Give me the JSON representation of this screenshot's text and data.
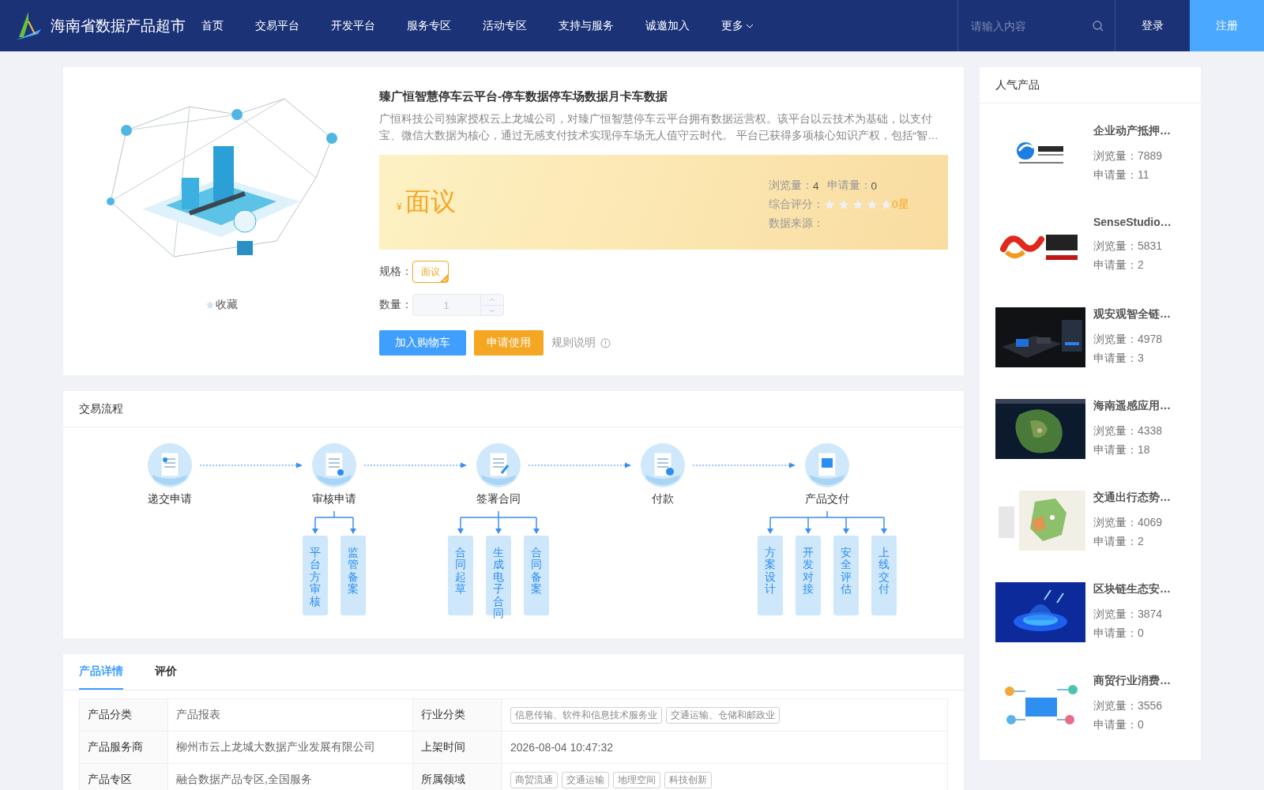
{
  "header": {
    "site_name": "海南省数据产品超市",
    "nav": [
      {
        "label": "首页",
        "dropdown": false
      },
      {
        "label": "交易平台",
        "dropdown": false
      },
      {
        "label": "开发平台",
        "dropdown": false
      },
      {
        "label": "服务专区",
        "dropdown": false
      },
      {
        "label": "活动专区",
        "dropdown": false
      },
      {
        "label": "支持与服务",
        "dropdown": false
      },
      {
        "label": "诚邀加入",
        "dropdown": false
      },
      {
        "label": "更多",
        "dropdown": true
      }
    ],
    "search": {
      "placeholder": "请输入内容"
    },
    "login": "登录",
    "register": "注册"
  },
  "product": {
    "favorite": "收藏",
    "title": "臻广恒智慧停车云平台-停车数据停车场数据月卡车数据",
    "description": "广恒科技公司独家授权云上龙城公司，对臻广恒智慧停车云平台拥有数据运营权。该平台以云技术为基础，以支付宝、微信大数据为核心，通过无感支付技术实现停车场无人值守云时代。 平台已获得多项核心知识产权，包括“智…",
    "currency": "¥",
    "price": "面议",
    "views_label": "浏览量：",
    "views": "4",
    "applies_label": "申请量：",
    "applies": "0",
    "rating_label": "综合评分：",
    "stars": 0,
    "rating_text": "0星",
    "source_label": "数据来源：",
    "spec_label": "规格：",
    "spec_options": [
      {
        "label": "面议",
        "selected": true
      }
    ],
    "quantity_label": "数量：",
    "quantity": "1",
    "quantity_disabled": true,
    "add_cart": "加入购物车",
    "apply": "申请使用",
    "rules": "规则说明"
  },
  "process": {
    "title": "交易流程",
    "steps": [
      {
        "label": "递交申请"
      },
      {
        "label": "审核申请",
        "children": [
          "平台方审核",
          "监管备案"
        ]
      },
      {
        "label": "签署合同",
        "children": [
          "合同起草",
          "生成电子合同",
          "合同备案"
        ]
      },
      {
        "label": "付款"
      },
      {
        "label": "产品交付",
        "children": [
          "方案设计",
          "开发对接",
          "安全评估",
          "上线交付"
        ]
      }
    ]
  },
  "detail_tabs": [
    {
      "label": "产品详情",
      "selected": true
    },
    {
      "label": "评价",
      "selected": false
    }
  ],
  "details": [
    [
      {
        "label": "产品分类",
        "kind": "text",
        "value": "产品报表"
      },
      {
        "label": "行业分类",
        "kind": "tags",
        "tags": [
          "信息传输、软件和信息技术服务业",
          "交通运输、仓储和邮政业"
        ]
      }
    ],
    [
      {
        "label": "产品服务商",
        "kind": "text",
        "value": "柳州市云上龙城大数据产业发展有限公司"
      },
      {
        "label": "上架时间",
        "kind": "text",
        "value": "2026-08-04 10:47:32"
      }
    ],
    [
      {
        "label": "产品专区",
        "kind": "text",
        "value": "融合数据产品专区,全国服务"
      },
      {
        "label": "所属领域",
        "kind": "tags",
        "tags": [
          "商贸流通",
          "交通运输",
          "地理空间",
          "科技创新"
        ]
      }
    ]
  ],
  "popular": {
    "title": "人气产品",
    "items": [
      {
        "name": "企业动产抵押…",
        "views": "浏览量：7889",
        "applies": "申请量：11"
      },
      {
        "name": "SenseStudio…",
        "views": "浏览量：5831",
        "applies": "申请量：2"
      },
      {
        "name": "观安观智全链…",
        "views": "浏览量：4978",
        "applies": "申请量：3"
      },
      {
        "name": "海南遥感应用…",
        "views": "浏览量：4338",
        "applies": "申请量：18"
      },
      {
        "name": "交通出行态势…",
        "views": "浏览量：4069",
        "applies": "申请量：2"
      },
      {
        "name": "区块链生态安…",
        "views": "浏览量：3874",
        "applies": "申请量：0"
      },
      {
        "name": "商贸行业消费…",
        "views": "浏览量：3556",
        "applies": "申请量：0"
      }
    ]
  }
}
